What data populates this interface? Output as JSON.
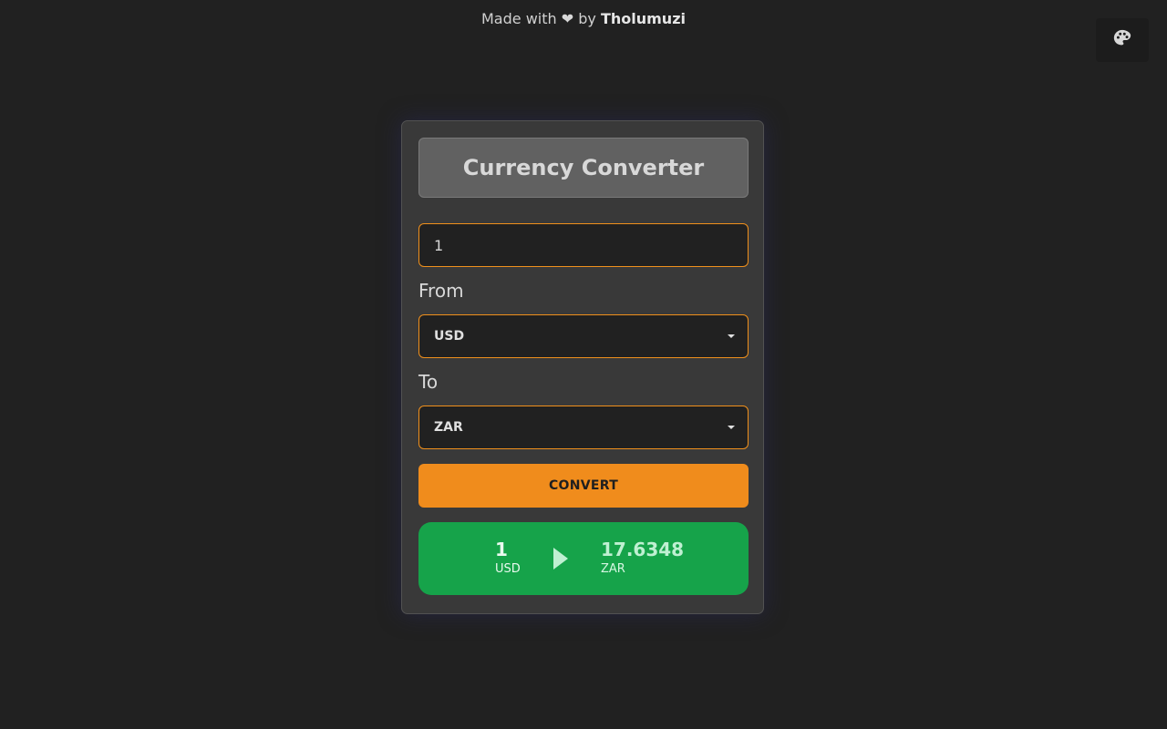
{
  "header": {
    "credit_prefix": "Made with",
    "credit_heart": "❤",
    "credit_by": "by",
    "credit_author": "Tholumuzi"
  },
  "theme_button": {
    "icon": "palette-icon"
  },
  "converter": {
    "title": "Currency Converter",
    "amount_value": "1",
    "from_label": "From",
    "from_value": "USD",
    "to_label": "To",
    "to_value": "ZAR",
    "convert_label": "CONVERT",
    "result": {
      "from_amount": "1",
      "from_code": "USD",
      "to_amount": "17.6348",
      "to_code": "ZAR"
    }
  },
  "colors": {
    "accent": "#f08c1c",
    "success": "#16a34a",
    "background": "#212121",
    "card": "#393939"
  }
}
